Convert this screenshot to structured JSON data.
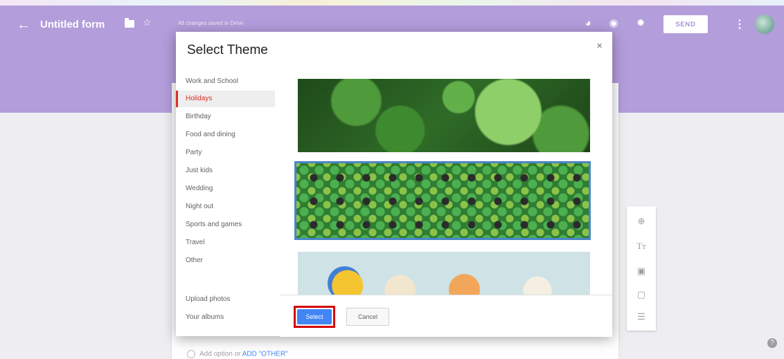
{
  "header": {
    "title": "Untitled form",
    "saved_text": "All changes saved in Drive",
    "send_label": "SEND",
    "back_icon": "arrow-left-icon",
    "folder_icon": "folder-icon",
    "star_icon": "star-icon",
    "palette_icon": "palette-icon",
    "preview_icon": "eye-icon",
    "settings_icon": "gear-icon",
    "more_icon": "more-vert-icon",
    "accent_color": "#b39ddb"
  },
  "dialog": {
    "title": "Select Theme",
    "close_icon": "close-icon",
    "categories": [
      "Work and School",
      "Holidays",
      "Birthday",
      "Food and dining",
      "Party",
      "Just kids",
      "Wedding",
      "Night out",
      "Sports and games",
      "Travel",
      "Other"
    ],
    "selected_category": "Holidays",
    "bottom_links": [
      "Upload photos",
      "Your albums"
    ],
    "select_label": "Select",
    "cancel_label": "Cancel"
  },
  "form": {
    "add_other_text": "Add option or",
    "add_other_link": "ADD \"OTHER\""
  },
  "side_toolbar": {
    "icons": [
      "add-circle-icon",
      "title-text-icon",
      "image-icon",
      "video-icon",
      "section-icon"
    ]
  },
  "help_icon": "help-icon"
}
